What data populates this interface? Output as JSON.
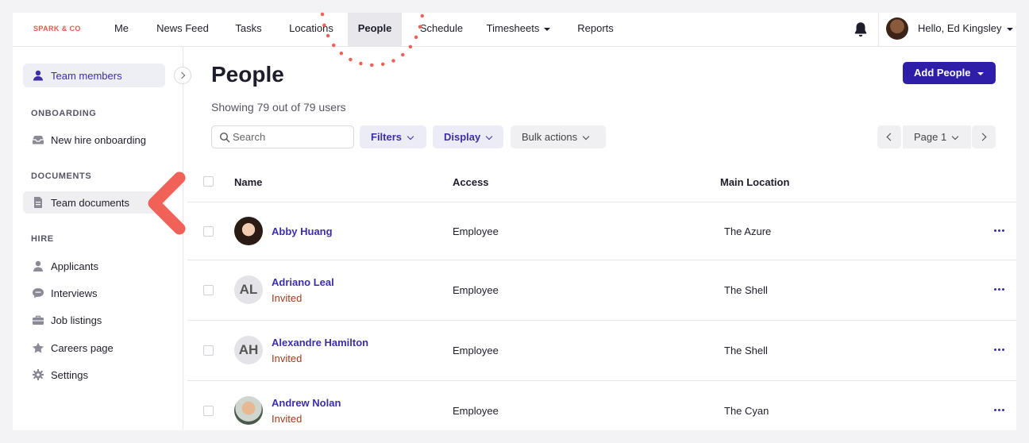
{
  "nav": {
    "brand": "SPARK & CO",
    "items": [
      {
        "label": "Me"
      },
      {
        "label": "News Feed"
      },
      {
        "label": "Tasks"
      },
      {
        "label": "Locations"
      },
      {
        "label": "People"
      },
      {
        "label": "Schedule"
      },
      {
        "label": "Timesheets"
      },
      {
        "label": "Reports"
      }
    ],
    "active": "People",
    "greeting": "Hello, Ed Kingsley"
  },
  "sidebar": {
    "active_item": "Team members",
    "sections": [
      {
        "heading": "ONBOARDING",
        "items": [
          {
            "label": "New hire onboarding",
            "icon": "inbox-icon"
          }
        ]
      },
      {
        "heading": "DOCUMENTS",
        "items": [
          {
            "label": "Team documents",
            "icon": "document-icon"
          }
        ]
      },
      {
        "heading": "HIRE",
        "items": [
          {
            "label": "Applicants",
            "icon": "person-icon"
          },
          {
            "label": "Interviews",
            "icon": "chat-icon"
          },
          {
            "label": "Job listings",
            "icon": "briefcase-icon"
          },
          {
            "label": "Careers page",
            "icon": "star-icon"
          },
          {
            "label": "Settings",
            "icon": "gear-icon"
          }
        ]
      }
    ]
  },
  "main": {
    "title": "People",
    "subtitle": "Showing 79 out of 79 users",
    "add_button": "Add People",
    "search_placeholder": "Search",
    "filters_label": "Filters",
    "display_label": "Display",
    "bulk_label": "Bulk actions",
    "page_label": "Page 1"
  },
  "table": {
    "columns": [
      "Name",
      "Access",
      "Main Location"
    ],
    "rows": [
      {
        "name": "Abby Huang",
        "status": "",
        "initials": "",
        "access": "Employee",
        "location": "The Azure"
      },
      {
        "name": "Adriano Leal",
        "status": "Invited",
        "initials": "AL",
        "access": "Employee",
        "location": "The Shell"
      },
      {
        "name": "Alexandre Hamilton",
        "status": "Invited",
        "initials": "AH",
        "access": "Employee",
        "location": "The Shell"
      },
      {
        "name": "Andrew Nolan",
        "status": "Invited",
        "initials": "",
        "access": "Employee",
        "location": "The Cyan"
      }
    ]
  },
  "colors": {
    "accent": "#2e1ea8",
    "link": "#3b2ea8",
    "invited": "#a53a1c",
    "annotation": "#f26157"
  }
}
